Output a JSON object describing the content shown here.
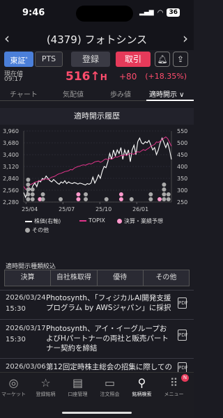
{
  "status_bar": {
    "time": "9:46",
    "signal": "▂▄▆",
    "wifi": "wifi",
    "battery": "36"
  },
  "header": {
    "title": "(4379) フォトシンス",
    "back_icon": "‹",
    "forward_icon": "›"
  },
  "actions": {
    "market_primary": "東証",
    "market_secondary": "PTS",
    "register": "登録",
    "trade": "取引",
    "bell_icon": "bell-icon",
    "share_icon": "share-icon"
  },
  "price": {
    "label_now": "現在値",
    "time": "09:17",
    "value": "516",
    "arrow": "↑",
    "high_mark": "H",
    "change": "+80",
    "change_pct": "(+18.35%)",
    "up_color": "#ff4d6d"
  },
  "tabs": [
    {
      "label": "チャート"
    },
    {
      "label": "気配値"
    },
    {
      "label": "歩み値"
    },
    {
      "label": "適時開示 ∨"
    }
  ],
  "section_title": "適時開示履歴",
  "chart_data": {
    "type": "line",
    "x_ticks": [
      "25/04",
      "25/07",
      "25/10",
      "26/01"
    ],
    "y_left": {
      "ticks": [
        3960,
        3680,
        3400,
        3120,
        2840,
        2560,
        2280
      ],
      "range": [
        2280,
        3960
      ]
    },
    "y_right": {
      "ticks": [
        550,
        500,
        450,
        400,
        350,
        300,
        250
      ],
      "range": [
        250,
        550
      ]
    },
    "series": [
      {
        "name": "株価(右軸)",
        "color": "#ffffff",
        "axis": "right",
        "values": [
          290,
          270,
          295,
          310,
          300,
          320,
          330,
          315,
          340,
          335,
          350,
          345,
          360,
          350,
          340,
          335,
          345,
          338,
          330,
          325,
          335,
          330,
          340,
          328,
          335,
          330,
          328,
          332,
          330,
          326,
          330,
          328,
          325,
          322,
          328,
          325,
          330,
          355,
          330,
          345,
          365,
          350,
          380,
          400,
          395,
          420,
          455,
          430,
          470,
          445,
          470,
          455,
          480,
          430,
          470,
          448,
          470,
          420,
          470,
          490,
          450,
          505,
          520,
          500,
          495,
          505,
          500,
          510,
          490,
          470,
          480,
          450,
          470,
          500,
          520,
          500,
          480,
          500,
          470,
          430
        ]
      },
      {
        "name": "TOPIX",
        "color": "#e0348a",
        "axis": "left",
        "values": [
          2650,
          2580,
          2600,
          2680,
          2700,
          2720,
          2750,
          2760,
          2780,
          2790,
          2800,
          2820,
          2830,
          2810,
          2840,
          2870,
          2880,
          2900,
          2930,
          2950,
          2960,
          2980,
          3000,
          3010,
          3020,
          3050,
          3040,
          3080,
          3100,
          3120,
          3130,
          3150,
          3160,
          3150,
          3170,
          3190,
          3180,
          3200,
          3230,
          3240,
          3250,
          3220,
          3240,
          3280,
          3300,
          3280,
          3310,
          3290,
          3320,
          3350,
          3340,
          3360,
          3380,
          3370,
          3400,
          3380,
          3410,
          3430,
          3420,
          3410,
          3450,
          3470,
          3460,
          3490,
          3520,
          3500,
          3530,
          3560,
          3600,
          3620,
          3640,
          3700,
          3690,
          3720,
          3760,
          3790,
          3820,
          3780,
          3690,
          3600
        ]
      }
    ],
    "events": [
      {
        "name": "決算・業績予想",
        "color": "#ff99cc"
      },
      {
        "name": "その他",
        "color": "#aaaaaa"
      }
    ],
    "markers": [
      {
        "x": 0.03,
        "type": "その他",
        "count": 5
      },
      {
        "x": 0.06,
        "type": "その他",
        "count": 3
      },
      {
        "x": 0.11,
        "type": "決算・業績予想",
        "count": 1
      },
      {
        "x": 0.13,
        "type": "その他",
        "count": 2
      },
      {
        "x": 0.25,
        "type": "その他",
        "count": 1
      },
      {
        "x": 0.37,
        "type": "決算・業績予想",
        "count": 2
      },
      {
        "x": 0.42,
        "type": "その他",
        "count": 2
      },
      {
        "x": 0.56,
        "type": "その他",
        "count": 1
      },
      {
        "x": 0.66,
        "type": "決算・業績予想",
        "count": 2
      },
      {
        "x": 0.73,
        "type": "その他",
        "count": 1
      },
      {
        "x": 0.86,
        "type": "その他",
        "count": 2
      },
      {
        "x": 0.92,
        "type": "決算・業績予想",
        "count": 1
      },
      {
        "x": 0.95,
        "type": "その他",
        "count": 4
      },
      {
        "x": 0.98,
        "type": "その他",
        "count": 2
      }
    ],
    "grid": true,
    "legend": "bottom"
  },
  "filter": {
    "label": "適時開示種類絞込",
    "buttons": [
      "決算",
      "自社株取得",
      "優待",
      "その他"
    ]
  },
  "news": [
    {
      "date": "2026/03/24",
      "time": "15:30",
      "text": "Photosynth、「フィジカルAI開発支援プログラム by AWSジャパン」に採択",
      "icon": "pdf-icon"
    },
    {
      "date": "2026/03/17",
      "time": "15:30",
      "text": "Photosynth、アイ・イーグループおよびHパートナーの両社と販売パートナー契約を締結",
      "icon": "pdf-icon"
    },
    {
      "date": "2026/03/06",
      "time": "",
      "text": "第12回定時株主総会の招集に際しての",
      "icon": "pdf-icon"
    }
  ],
  "bottom_nav": [
    {
      "label": "マーケット",
      "icon": "◎"
    },
    {
      "label": "登録銘柄",
      "icon": "☆"
    },
    {
      "label": "口座管理",
      "icon": "▤"
    },
    {
      "label": "注文照会",
      "icon": "▭"
    },
    {
      "label": "銘柄検索",
      "icon": "⚲",
      "active": true
    },
    {
      "label": "メニュー",
      "icon": "⠿",
      "badge": "N"
    }
  ]
}
